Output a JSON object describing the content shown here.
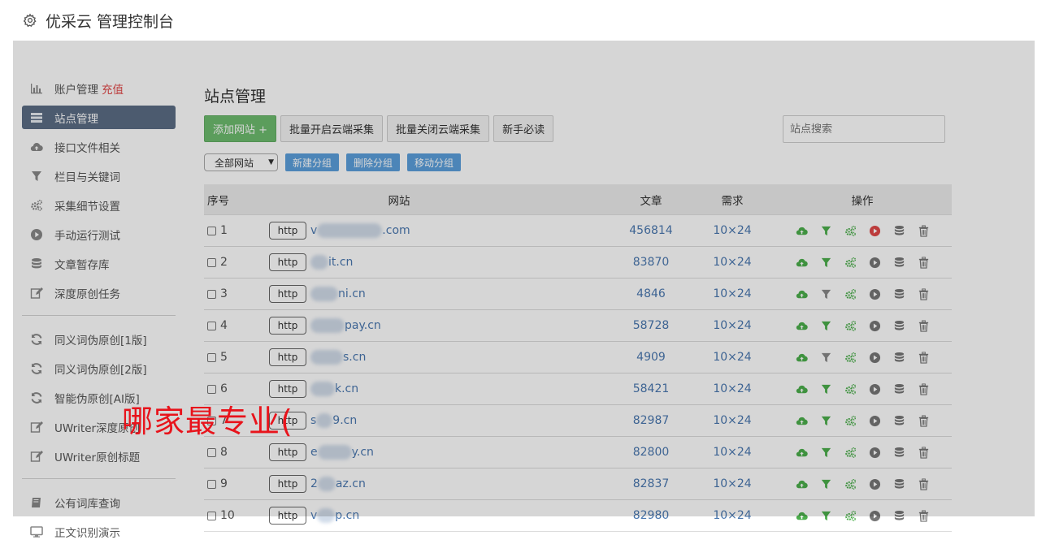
{
  "header": {
    "title": "优采云 管理控制台"
  },
  "sidebar": {
    "group1": [
      {
        "label": "账户管理",
        "extra": "充值",
        "icon": "bar-chart-icon"
      },
      {
        "label": "站点管理",
        "icon": "list-icon",
        "active": true
      },
      {
        "label": "接口文件相关",
        "icon": "cloud-upload-icon"
      },
      {
        "label": "栏目与关键词",
        "icon": "filter-icon"
      },
      {
        "label": "采集细节设置",
        "icon": "gears-icon"
      },
      {
        "label": "手动运行测试",
        "icon": "play-circle-icon"
      },
      {
        "label": "文章暂存库",
        "icon": "database-icon"
      },
      {
        "label": "深度原创任务",
        "icon": "edit-icon"
      }
    ],
    "group2": [
      {
        "label": "同义词伪原创[1版]",
        "icon": "refresh-icon"
      },
      {
        "label": "同义词伪原创[2版]",
        "icon": "refresh-icon"
      },
      {
        "label": "智能伪原创[AI版]",
        "icon": "refresh-icon"
      },
      {
        "label": "UWriter深度原创",
        "icon": "edit-icon"
      },
      {
        "label": "UWriter原创标题",
        "icon": "edit-icon"
      }
    ],
    "group3": [
      {
        "label": "公有词库查询",
        "icon": "book-icon"
      },
      {
        "label": "正文识别演示",
        "icon": "monitor-icon"
      }
    ]
  },
  "main": {
    "title": "站点管理",
    "buttons": {
      "add_site": "添加网站 +",
      "batch_on": "批量开启云端采集",
      "batch_off": "批量关闭云端采集",
      "guide": "新手必读"
    },
    "search_placeholder": "站点搜索",
    "filter": {
      "select_value": "全部网站",
      "new_group": "新建分组",
      "delete_group": "删除分组",
      "move_group": "移动分组"
    },
    "table": {
      "headers": {
        "no": "序号",
        "site": "网站",
        "articles": "文章",
        "demand": "需求",
        "ops": "操作"
      },
      "rows": [
        {
          "no": "1",
          "prefix": "v",
          "suffix": ".com",
          "articles": "456814",
          "demand": "10×24",
          "running": true,
          "filter_active": true
        },
        {
          "no": "2",
          "prefix": "",
          "suffix": "it.cn",
          "articles": "83870",
          "demand": "10×24",
          "running": false,
          "filter_active": true
        },
        {
          "no": "3",
          "prefix": "",
          "suffix": "ni.cn",
          "articles": "4846",
          "demand": "10×24",
          "running": false,
          "filter_active": false
        },
        {
          "no": "4",
          "prefix": "",
          "suffix": "pay.cn",
          "articles": "58728",
          "demand": "10×24",
          "running": false,
          "filter_active": true
        },
        {
          "no": "5",
          "prefix": "",
          "suffix": "s.cn",
          "articles": "4909",
          "demand": "10×24",
          "running": false,
          "filter_active": false
        },
        {
          "no": "6",
          "prefix": "",
          "suffix": "k.cn",
          "articles": "58421",
          "demand": "10×24",
          "running": false,
          "filter_active": true
        },
        {
          "no": "7",
          "prefix": "s",
          "suffix": "9.cn",
          "articles": "82987",
          "demand": "10×24",
          "running": false,
          "filter_active": true
        },
        {
          "no": "8",
          "prefix": "e",
          "suffix": "y.cn",
          "articles": "82800",
          "demand": "10×24",
          "running": false,
          "filter_active": true
        },
        {
          "no": "9",
          "prefix": "2",
          "suffix": "az.cn",
          "articles": "82837",
          "demand": "10×24",
          "running": false,
          "filter_active": true
        },
        {
          "no": "10",
          "prefix": "v",
          "suffix": "p.cn",
          "articles": "82980",
          "demand": "10×24",
          "running": false,
          "filter_active": true
        }
      ],
      "http_label": "http"
    }
  },
  "watermark": "哪家最专业(",
  "colors": {
    "accent": "#5b6d85",
    "green": "#4cae4c",
    "link": "#4a78b0",
    "red": "#e04848"
  }
}
